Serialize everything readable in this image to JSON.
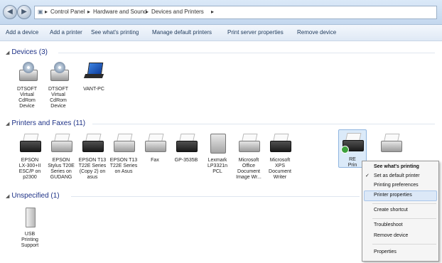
{
  "address": {
    "back_glyph": "◀",
    "forward_glyph": "▶",
    "crumbs": [
      "Control Panel",
      "Hardware and Sound",
      "Devices and Printers"
    ],
    "sep": "▸"
  },
  "commands": [
    "Add a device",
    "Add a printer",
    "See what's printing",
    "Manage default printers",
    "Print server properties",
    "Remove device"
  ],
  "devices": {
    "header": "Devices (3)",
    "items": [
      "DTSOFT\nVirtual\nCdRom\nDevice",
      "DTSOFT\nVirtual\nCdRom\nDevice",
      "VANT-PC"
    ]
  },
  "printers": {
    "header": "Printers and Faxes (11)",
    "items": [
      "EPSON\nLX-300+II\nESC/P on\np2300",
      "EPSON\nStylus T20E\nSeries on\nGUDANG",
      "EPSON T13\nT22E Series\n(Copy 2) on\nasus",
      "EPSON T13\nT22E Series\non Asus",
      "Fax",
      "GP-3535B",
      "Lexmark\nLP3321n PCL",
      "Microsoft\nOffice\nDocument\nImage Wr...",
      "Microsoft\nXPS\nDocument\nWriter",
      "RE\nPrin",
      ""
    ]
  },
  "unspecified": {
    "header": "Unspecified (1)",
    "items": [
      "USB\nPrinting\nSupport"
    ]
  },
  "context_menu": {
    "items": [
      "See what's printing",
      "Set as default printer",
      "Printing preferences",
      "Printer properties",
      "Create shortcut",
      "Troubleshoot",
      "Remove device",
      "Properties"
    ],
    "check": "✓"
  }
}
